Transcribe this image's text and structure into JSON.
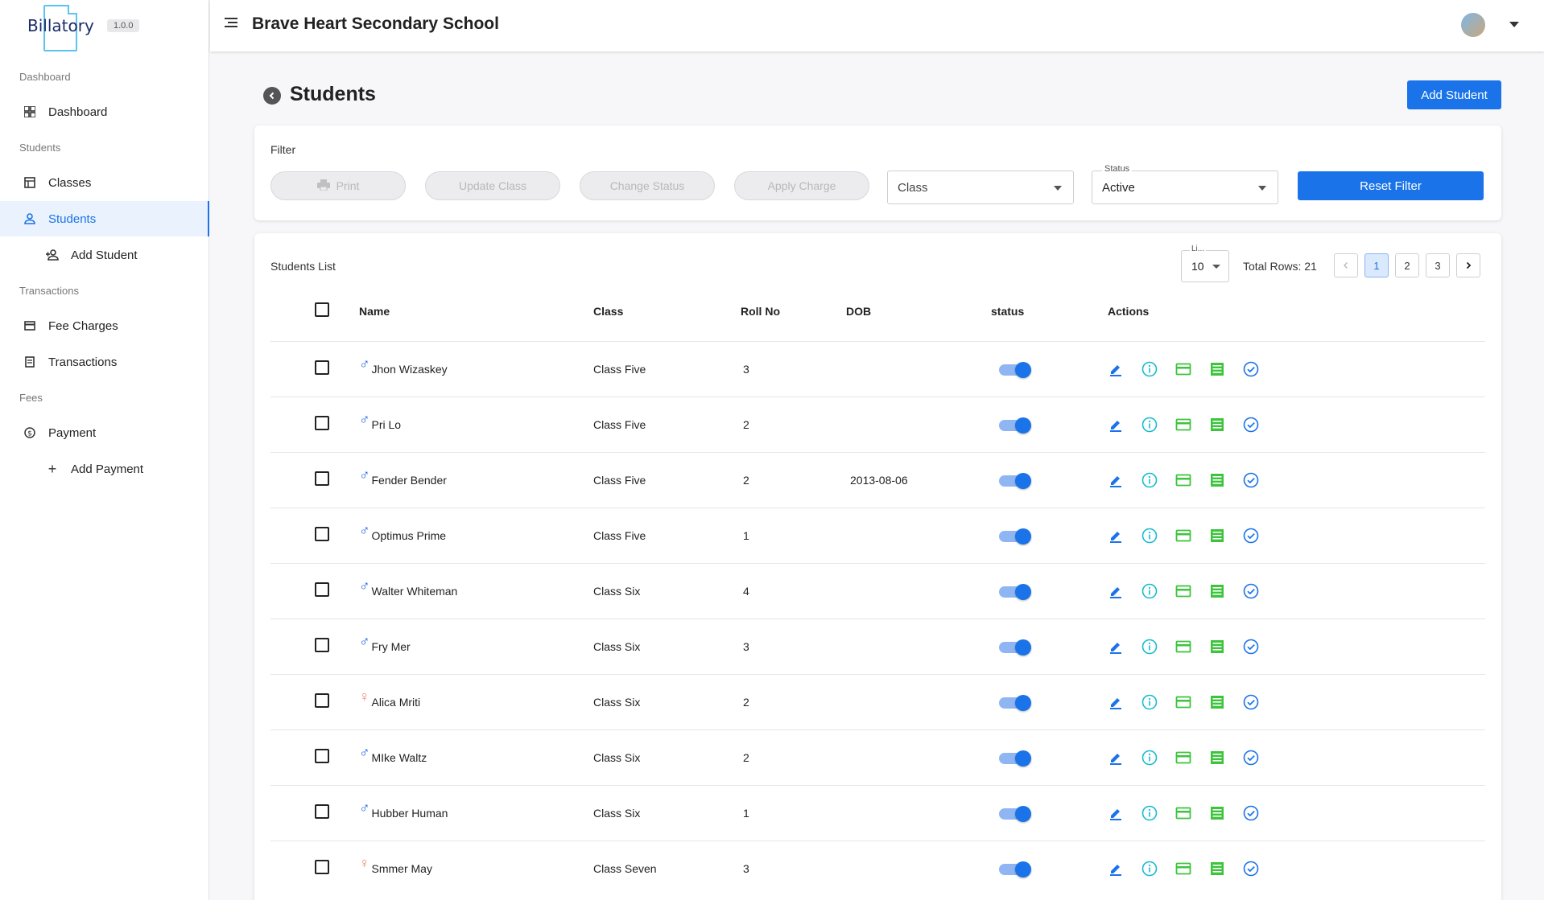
{
  "app": {
    "brand": "Billatory",
    "version": "1.0.0"
  },
  "topbar": {
    "school_name": "Brave Heart Secondary School"
  },
  "sidebar": {
    "sections": [
      "Dashboard",
      "Students",
      "Transactions",
      "Fees"
    ],
    "items": [
      {
        "label": "Dashboard",
        "icon": "dashboard-icon"
      },
      {
        "label": "Classes",
        "icon": "classes-icon"
      },
      {
        "label": "Students",
        "icon": "person-icon",
        "active": true
      },
      {
        "label": "Add Student",
        "icon": "person-add-icon"
      },
      {
        "label": "Fee Charges",
        "icon": "card-icon"
      },
      {
        "label": "Transactions",
        "icon": "receipt-icon"
      },
      {
        "label": "Payment",
        "icon": "dollar-icon"
      },
      {
        "label": "Add Payment",
        "icon": "plus-icon"
      }
    ]
  },
  "page": {
    "title": "Students",
    "add_button": "Add Student"
  },
  "filter": {
    "label": "Filter",
    "buttons": [
      "Print",
      "Update Class",
      "Change Status",
      "Apply Charge"
    ],
    "class_placeholder": "Class",
    "status_label": "Status",
    "status_value": "Active",
    "reset_label": "Reset Filter"
  },
  "list": {
    "title": "Students List",
    "limit_label": "Li...",
    "limit_value": "10",
    "total_rows": "Total Rows: 21",
    "pages": [
      "1",
      "2",
      "3"
    ],
    "current_page": "1",
    "columns": [
      "Name",
      "Class",
      "Roll No",
      "DOB",
      "status",
      "Actions"
    ],
    "rows": [
      {
        "gender": "male",
        "name": "Jhon Wizaskey",
        "class": "Class Five",
        "roll": "3",
        "dob": "",
        "active": true
      },
      {
        "gender": "male",
        "name": "Pri Lo",
        "class": "Class Five",
        "roll": "2",
        "dob": "",
        "active": true
      },
      {
        "gender": "male",
        "name": "Fender Bender",
        "class": "Class Five",
        "roll": "2",
        "dob": "2013-08-06",
        "active": true
      },
      {
        "gender": "male",
        "name": "Optimus Prime",
        "class": "Class Five",
        "roll": "1",
        "dob": "",
        "active": true
      },
      {
        "gender": "male",
        "name": "Walter Whiteman",
        "class": "Class Six",
        "roll": "4",
        "dob": "",
        "active": true
      },
      {
        "gender": "male",
        "name": "Fry Mer",
        "class": "Class Six",
        "roll": "3",
        "dob": "",
        "active": true
      },
      {
        "gender": "female",
        "name": "Alica Mriti",
        "class": "Class Six",
        "roll": "2",
        "dob": "",
        "active": true
      },
      {
        "gender": "male",
        "name": "MIke Waltz",
        "class": "Class Six",
        "roll": "2",
        "dob": "",
        "active": true
      },
      {
        "gender": "male",
        "name": "Hubber Human",
        "class": "Class Six",
        "roll": "1",
        "dob": "",
        "active": true
      },
      {
        "gender": "female",
        "name": "Smmer May",
        "class": "Class Seven",
        "roll": "3",
        "dob": "",
        "active": true
      }
    ],
    "actions": [
      {
        "icon": "edit-icon",
        "color": "#1a73e8"
      },
      {
        "icon": "info-icon",
        "color": "#17bcd0"
      },
      {
        "icon": "card-icon",
        "color": "#3cc43c"
      },
      {
        "icon": "ledger-icon",
        "color": "#3cc43c"
      },
      {
        "icon": "check-circle-icon",
        "color": "#1a73e8"
      }
    ]
  },
  "colors": {
    "primary": "#1a73e8",
    "male": "#1a5ee0",
    "female": "#f0896b",
    "green": "#3cc43c",
    "cyan": "#17bcd0"
  }
}
